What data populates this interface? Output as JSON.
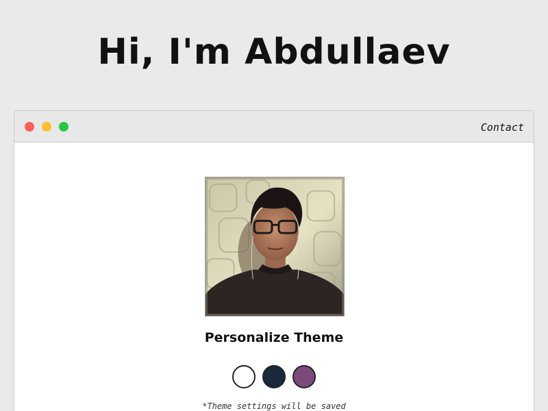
{
  "hero": {
    "title": "Hi, I'm Abdullaev"
  },
  "window": {
    "controls": [
      {
        "name": "close",
        "color": "#fd5f57"
      },
      {
        "name": "minimize",
        "color": "#febc2e"
      },
      {
        "name": "maximize",
        "color": "#28c840"
      }
    ],
    "nav_link": "Contact"
  },
  "profile": {
    "photo_alt": "profile photo"
  },
  "theme": {
    "title": "Personalize Theme",
    "swatches": [
      {
        "name": "light",
        "color": "#ffffff"
      },
      {
        "name": "dark-blue",
        "color": "#19293b"
      },
      {
        "name": "purple",
        "color": "#7c4a7a"
      }
    ],
    "note": "*Theme settings will be saved"
  }
}
